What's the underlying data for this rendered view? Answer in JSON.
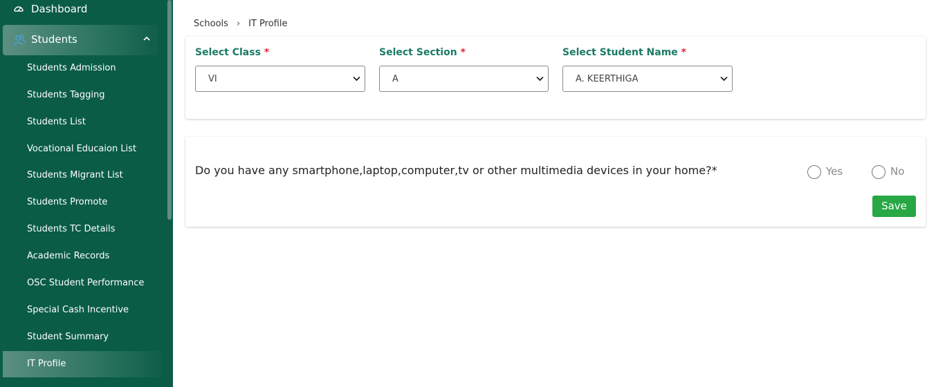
{
  "sidebar": {
    "dashboard": {
      "label": "Dashboard",
      "icon": "speedometer-icon"
    },
    "group": {
      "label": "Students",
      "icon": "users-icon",
      "chevron": "chevron-up-icon",
      "expanded": true
    },
    "items": [
      {
        "label": "Students Admission"
      },
      {
        "label": "Students Tagging"
      },
      {
        "label": "Students List"
      },
      {
        "label": "Vocational Educaion List"
      },
      {
        "label": "Students Migrant List"
      },
      {
        "label": "Students Promote"
      },
      {
        "label": "Students TC Details"
      },
      {
        "label": "Academic Records"
      },
      {
        "label": "OSC Student Performance"
      },
      {
        "label": "Special Cash Incentive"
      },
      {
        "label": "Student Summary"
      },
      {
        "label": "IT Profile",
        "active": true
      }
    ]
  },
  "breadcrumb": {
    "root": "Schools",
    "separator": "›",
    "current": "IT Profile"
  },
  "filters": {
    "class": {
      "label": "Select Class",
      "required_mark": "*",
      "value": "VI"
    },
    "section": {
      "label": "Select Section",
      "required_mark": "*",
      "value": "A"
    },
    "student": {
      "label": "Select Student Name",
      "required_mark": "*",
      "value": "A. KEERTHIGA"
    }
  },
  "question": {
    "text": "Do you have any smartphone,laptop,computer,tv or other multimedia devices in your home?*",
    "options": [
      {
        "label": "Yes",
        "selected": false
      },
      {
        "label": "No",
        "selected": false
      }
    ]
  },
  "actions": {
    "save_label": "Save"
  },
  "colors": {
    "sidebar_bg": "#0a5c47",
    "label_green": "#1a7a64",
    "required_red": "#e0283a",
    "save_green": "#28a745"
  }
}
